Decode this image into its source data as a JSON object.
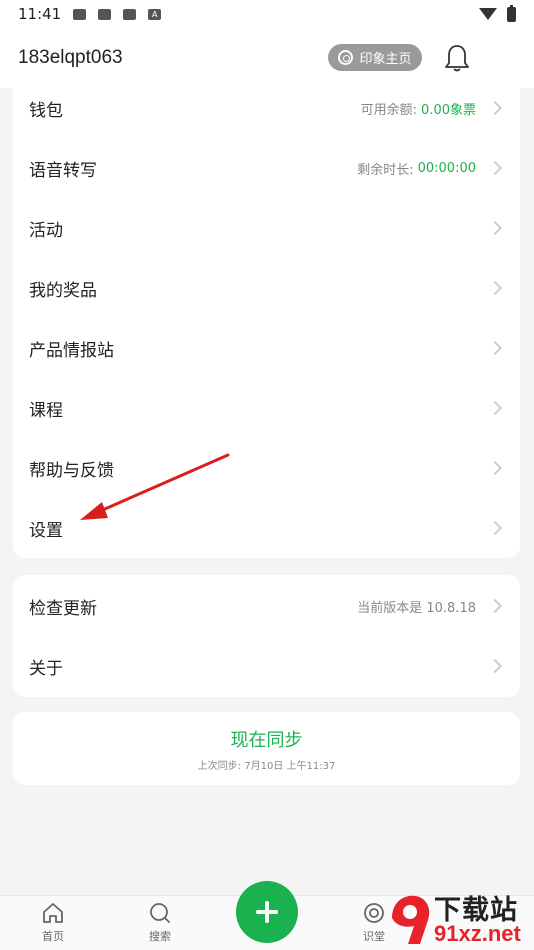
{
  "status_bar": {
    "time": "11:41",
    "notif_a": "A"
  },
  "header": {
    "account": "183elqpt063",
    "home_label": "印象主页"
  },
  "menu": [
    {
      "label": "钱包",
      "hint": "可用余额:",
      "value": "0.00象票"
    },
    {
      "label": "语音转写",
      "hint": "剩余时长:",
      "value": "00:00:00"
    },
    {
      "label": "活动"
    },
    {
      "label": "我的奖品"
    },
    {
      "label": "产品情报站"
    },
    {
      "label": "课程"
    },
    {
      "label": "帮助与反馈"
    },
    {
      "label": "设置"
    }
  ],
  "menu2": [
    {
      "label": "检查更新",
      "hint": "当前版本是 10.8.18"
    },
    {
      "label": "关于"
    }
  ],
  "sync": {
    "title": "现在同步",
    "subtitle": "上次同步: 7月10日 上午11:37"
  },
  "tabs": [
    {
      "label": "首页",
      "icon": "home-icon"
    },
    {
      "label": "搜索",
      "icon": "search-icon"
    },
    {
      "label": "识堂",
      "icon": "target-icon"
    }
  ],
  "watermark": {
    "line1": "下载站",
    "line2": "91xz.net"
  },
  "colors": {
    "accent": "#1ab24f",
    "arrow": "#d81e1e"
  }
}
